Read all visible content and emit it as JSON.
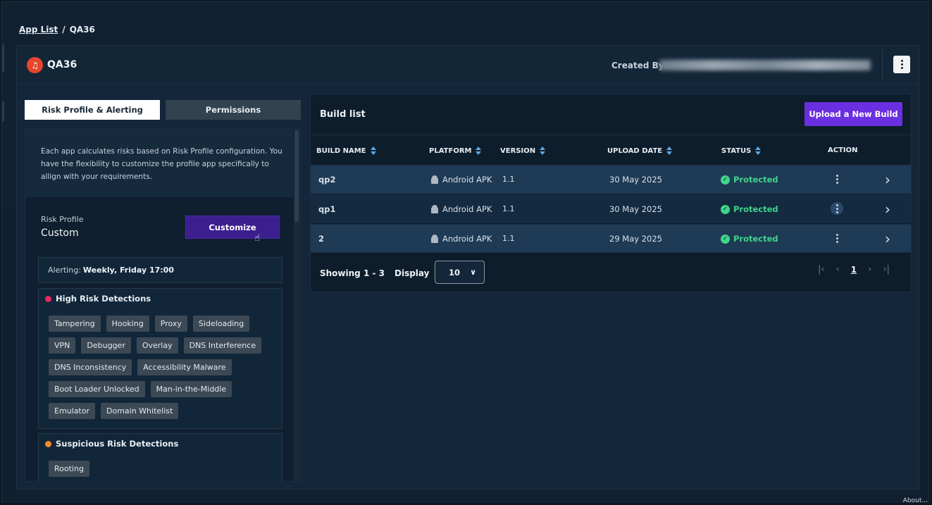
{
  "breadcrumb": {
    "root": "App List",
    "separator": "/",
    "current": "QA36"
  },
  "header": {
    "app_icon": "music-note-icon",
    "app_icon_glyph": "♫",
    "app_name": "QA36",
    "created_by_label": "Created By:",
    "menu_icon": "kebab-icon"
  },
  "tabs": {
    "risk": "Risk Profile & Alerting",
    "permissions": "Permissions"
  },
  "risk": {
    "info": "Each app calculates risks based on Risk Profile configuration. You have the flexibility to customize the profile app specifically to allign with your requirements.",
    "profile_label": "Risk Profile",
    "profile_value": "Custom",
    "customize_label": "Customize",
    "alerting_label": "Alerting:",
    "alerting_value": "Weekly, Friday 17:00",
    "high": {
      "title": "High Risk Detections",
      "color": "#e8265a",
      "tags": [
        "Tampering",
        "Hooking",
        "Proxy",
        "Sideloading",
        "VPN",
        "Debugger",
        "Overlay",
        "DNS Interference",
        "DNS Inconsistency",
        "Accessibility Malware",
        "Boot Loader Unlocked",
        "Man-in-the-Middle",
        "Emulator",
        "Domain Whitelist"
      ]
    },
    "suspicious": {
      "title": "Suspicious Risk Detections",
      "color": "#f08a2c",
      "tags": [
        "Rooting"
      ]
    }
  },
  "builds": {
    "title": "Build list",
    "upload_label": "Upload a New Build",
    "columns": {
      "name": "BUILD NAME",
      "platform": "PLATFORM",
      "version": "VERSION",
      "date": "UPLOAD DATE",
      "status": "STATUS",
      "action": "ACTION"
    },
    "rows": [
      {
        "name": "qp2",
        "platform": "Android APK",
        "version": "1.1",
        "date": "30 May 2025",
        "status": "Protected"
      },
      {
        "name": "qp1",
        "platform": "Android APK",
        "version": "1.1",
        "date": "30 May 2025",
        "status": "Protected"
      },
      {
        "name": "2",
        "platform": "Android APK",
        "version": "1.1",
        "date": "29 May 2025",
        "status": "Protected"
      }
    ],
    "showing": "Showing 1 - 3",
    "display_label": "Display",
    "page_size": "10",
    "current_page": "1",
    "status_color": "#3fd58a",
    "accent": "#6a2fe0"
  },
  "footer": {
    "about": "About..."
  }
}
